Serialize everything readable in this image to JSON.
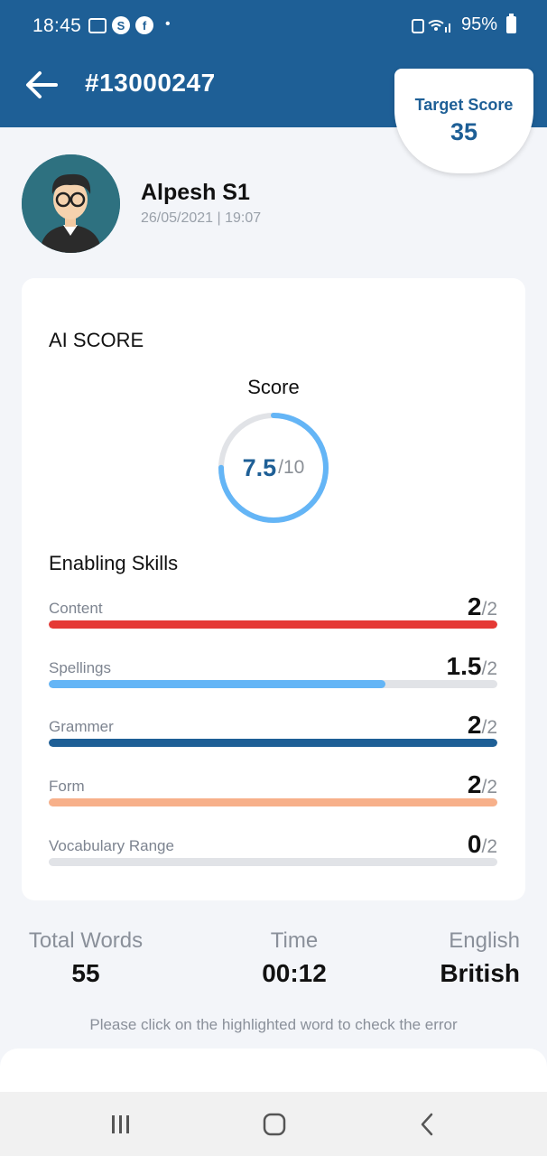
{
  "status_bar": {
    "time": "18:45",
    "battery": "95%",
    "icons": [
      "gallery-icon",
      "s-app-icon",
      "facebook-icon",
      "notification-dot"
    ]
  },
  "header": {
    "test_id": "#13000247",
    "target_score_label": "Target Score",
    "target_score_value": "35"
  },
  "profile": {
    "name": "Alpesh S1",
    "datetime": "26/05/2021 | 19:07"
  },
  "ai_score": {
    "title": "AI SCORE",
    "score_label": "Score",
    "score": "7.5",
    "max": "/10",
    "fraction": 0.75
  },
  "enabling_skills": {
    "title": "Enabling Skills",
    "items": [
      {
        "name": "Content",
        "score": "2",
        "max": "/2",
        "fraction": 1.0,
        "color": "#e53935"
      },
      {
        "name": "Spellings",
        "score": "1.5",
        "max": "/2",
        "fraction": 0.75,
        "color": "#64b5f6"
      },
      {
        "name": "Grammer",
        "score": "2",
        "max": "/2",
        "fraction": 1.0,
        "color": "#1e5f96"
      },
      {
        "name": "Form",
        "score": "2",
        "max": "/2",
        "fraction": 1.0,
        "color": "#f7b08a"
      },
      {
        "name": "Vocabulary Range",
        "score": "0",
        "max": "/2",
        "fraction": 0.0,
        "color": "#64b5f6"
      }
    ]
  },
  "stats": {
    "total_words_label": "Total Words",
    "total_words": "55",
    "time_label": "Time",
    "time": "00:12",
    "english_label": "English",
    "english": "British"
  },
  "hint": "Please click on the highlighted word to check the error",
  "colors": {
    "primary": "#1e5f96",
    "ring": "#64b5f6",
    "background": "#f3f5f9"
  }
}
